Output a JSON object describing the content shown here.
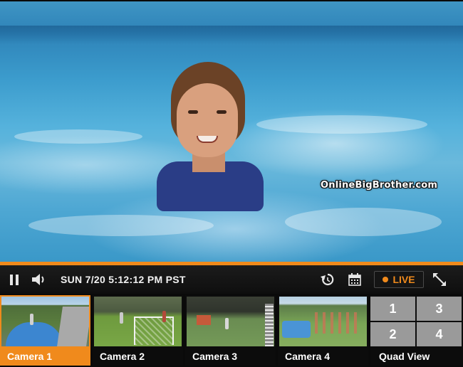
{
  "player": {
    "watermark": "OnlineBigBrother.com",
    "progress_fraction": 1.0,
    "datetime": "SUN 7/20 5:12:12 PM PST",
    "live_label": "LIVE"
  },
  "icons": {
    "pause": "pause-icon",
    "volume": "volume-icon",
    "replay": "replay-icon",
    "calendar": "calendar-icon",
    "fullscreen": "fullscreen-icon"
  },
  "colors": {
    "accent": "#f08a1c",
    "bar_bg": "#111111"
  },
  "cameras": [
    {
      "label": "Camera 1",
      "active": true
    },
    {
      "label": "Camera 2",
      "active": false
    },
    {
      "label": "Camera 3",
      "active": false
    },
    {
      "label": "Camera 4",
      "active": false
    }
  ],
  "quad_view": {
    "label": "Quad View",
    "cells": [
      "1",
      "3",
      "2",
      "4"
    ]
  }
}
